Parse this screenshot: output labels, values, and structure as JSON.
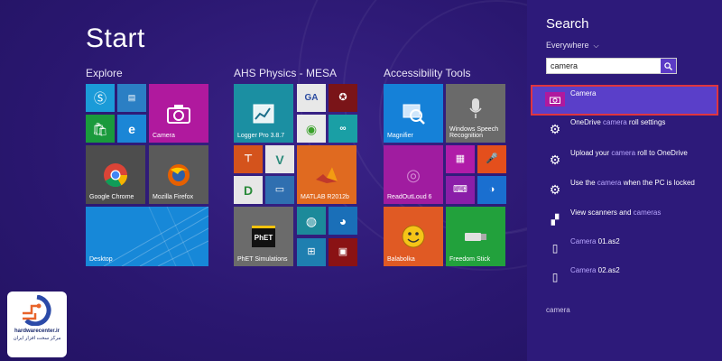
{
  "start": {
    "title": "Start",
    "groups": [
      "Explore",
      "AHS Physics - MESA",
      "Accessibility Tools"
    ],
    "tiles": {
      "camera": "Camera",
      "chrome": "Google Chrome",
      "firefox": "Mozilla Firefox",
      "desktop": "Desktop",
      "logger": "Logger Pro 3.8.7",
      "matlab": "MATLAB R2012b",
      "phet": "PhET Simulations",
      "magnifier": "Magnifier",
      "speech": "Windows Speech\nRecognition",
      "readout": "ReadOutLoud 6",
      "balabolka": "Balabolka",
      "freedom": "Freedom Stick"
    }
  },
  "search": {
    "title": "Search",
    "scope": "Everywhere",
    "query": "camera",
    "results": [
      {
        "pre": "",
        "hl": "Camera",
        "post": ""
      },
      {
        "pre": "OneDrive ",
        "hl": "camera",
        "post": " roll settings"
      },
      {
        "pre": "Upload your ",
        "hl": "camera",
        "post": " roll to OneDrive"
      },
      {
        "pre": "Use the ",
        "hl": "camera",
        "post": " when the PC is locked"
      },
      {
        "pre": "View scanners and ",
        "hl": "cameras",
        "post": ""
      },
      {
        "pre": "",
        "hl": "Camera",
        "post": " 01.as2"
      },
      {
        "pre": "",
        "hl": "Camera",
        "post": " 02.as2"
      }
    ],
    "footer": "camera"
  },
  "brand": {
    "name": "hardwarecenter.ir",
    "tagline": "مرکز سخت افزار ایران"
  },
  "colors": {
    "background": "#2a1770",
    "accent_purple": "#5a3fc9",
    "highlight_border": "#e0353f"
  }
}
